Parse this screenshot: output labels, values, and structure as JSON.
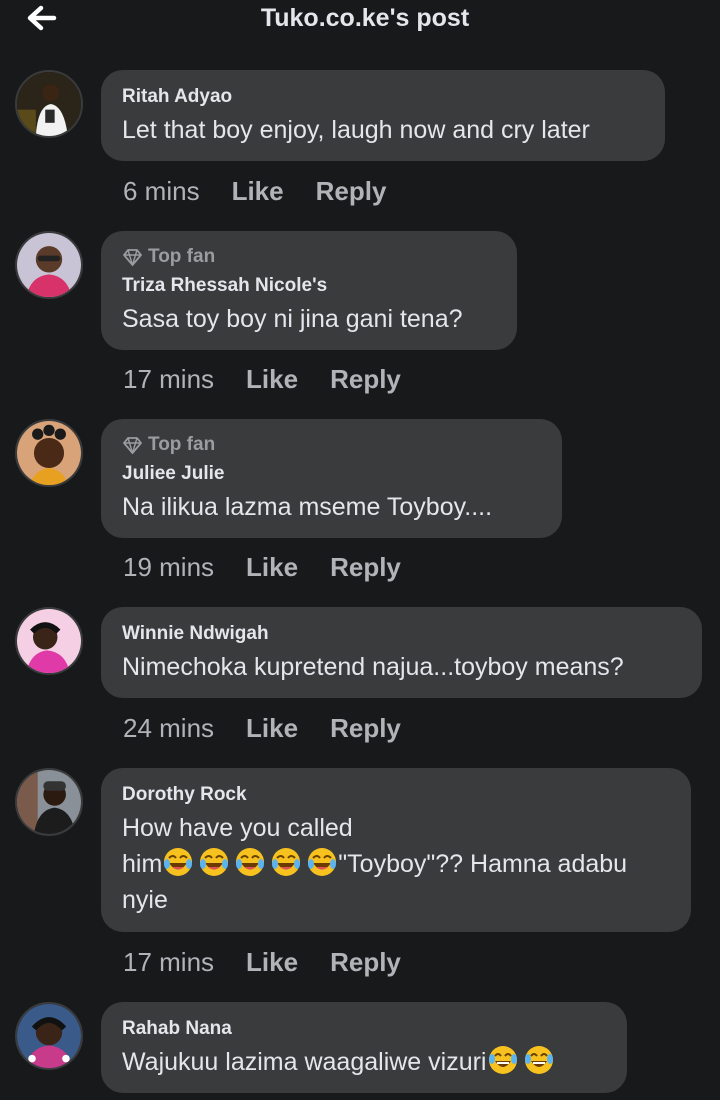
{
  "header": {
    "title": "Tuko.co.ke's post",
    "back_icon": "arrow-left-icon"
  },
  "colors": {
    "background": "#18191a",
    "bubble": "#3a3b3c",
    "text": "#e4e6eb",
    "muted": "#b0b3b8"
  },
  "actions": {
    "like": "Like",
    "reply": "Reply"
  },
  "comments": [
    {
      "author": "Ritah Adyao",
      "badge": "",
      "time": "6 mins",
      "text": "Let that boy enjoy, laugh now and cry later"
    },
    {
      "author": "Triza Rhessah Nicole's",
      "badge": "Top fan",
      "time": "17 mins",
      "text": "Sasa toy boy ni jina gani tena?"
    },
    {
      "author": "Juliee Julie",
      "badge": "Top fan",
      "time": "19 mins",
      "text": "Na ilikua lazma mseme Toyboy...."
    },
    {
      "author": "Winnie Ndwigah",
      "badge": "",
      "time": "24 mins",
      "text": "Nimechoka kupretend najua...toyboy means?"
    },
    {
      "author": "Dorothy Rock",
      "badge": "",
      "time": "17 mins",
      "text_line1": "How have you called",
      "text_line2_a": "him",
      "text_line2_b": "\"Toyboy\"?? Hamna adabu",
      "text_line3": "nyie"
    },
    {
      "author": "Rahab Nana",
      "badge": "",
      "time": "",
      "text": "Wajukuu lazima waagaliwe vizuri"
    }
  ]
}
